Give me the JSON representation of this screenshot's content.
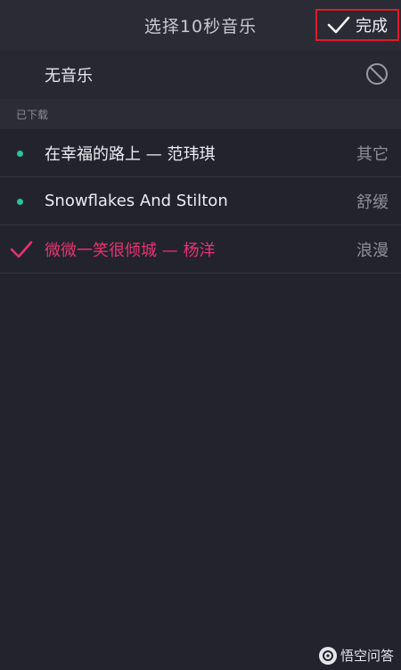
{
  "header": {
    "title": "选择10秒音乐",
    "done_label": "完成",
    "done_icon": "check-icon"
  },
  "no_music": {
    "label": "无音乐",
    "icon": "ban-icon"
  },
  "section": {
    "label": "已下载"
  },
  "songs": [
    {
      "title": "在幸福的路上 — 范玮琪",
      "genre": "其它",
      "state": "downloaded"
    },
    {
      "title": "Snowflakes And Stilton",
      "genre": "舒缓",
      "state": "downloaded"
    },
    {
      "title": "微微一笑很倾城 — 杨洋",
      "genre": "浪漫",
      "state": "selected"
    }
  ],
  "watermark": {
    "text": "悟空问答",
    "icon": "wukong-logo-icon"
  },
  "colors": {
    "background": "#22232d",
    "accent_pink": "#e9336f",
    "dot_green": "#29c499",
    "highlight_box": "#e01b2a"
  }
}
